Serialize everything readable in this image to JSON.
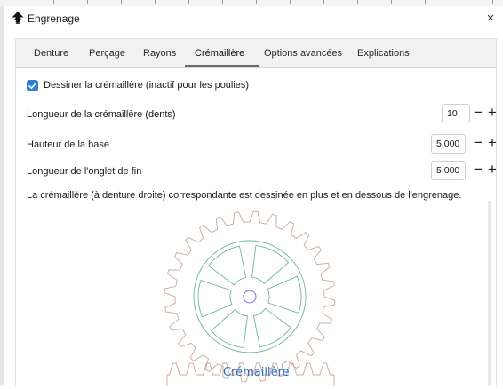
{
  "dialog": {
    "title": "Engrenage",
    "close_glyph": "×",
    "app_icon": "inkscape-icon"
  },
  "tabs": [
    {
      "label": "Denture",
      "active": false
    },
    {
      "label": "Perçage",
      "active": false
    },
    {
      "label": "Rayons",
      "active": false
    },
    {
      "label": "Crémaillère",
      "active": true
    },
    {
      "label": "Options avancées",
      "active": false
    },
    {
      "label": "Explications",
      "active": false
    }
  ],
  "rack": {
    "draw_checkbox": {
      "label": "Dessiner la crémaillère (inactif pour les poulies)",
      "checked": true
    },
    "length": {
      "label": "Longueur de la crémaillère (dents)",
      "value": "10"
    },
    "base_height": {
      "label": "Hauteur de la base",
      "value": "5,000"
    },
    "end_tab_length": {
      "label": "Longueur de l'onglet de fin",
      "value": "5,000"
    },
    "description": "La crémaillère (à denture droite) correspondante est dessinée en plus et en dessous de l'engrenage.",
    "preview_label": "Crémaillère"
  },
  "spin_glyphs": {
    "minus": "−",
    "plus": "+"
  },
  "colors": {
    "accent": "#2f7ed8",
    "gear_outline": "#c9a99a",
    "spoke_outline": "#6fb3a8",
    "center_hole": "#7b6cf0",
    "rack_outline": "#c9a99a",
    "preview_label": "#2f6fc0"
  }
}
